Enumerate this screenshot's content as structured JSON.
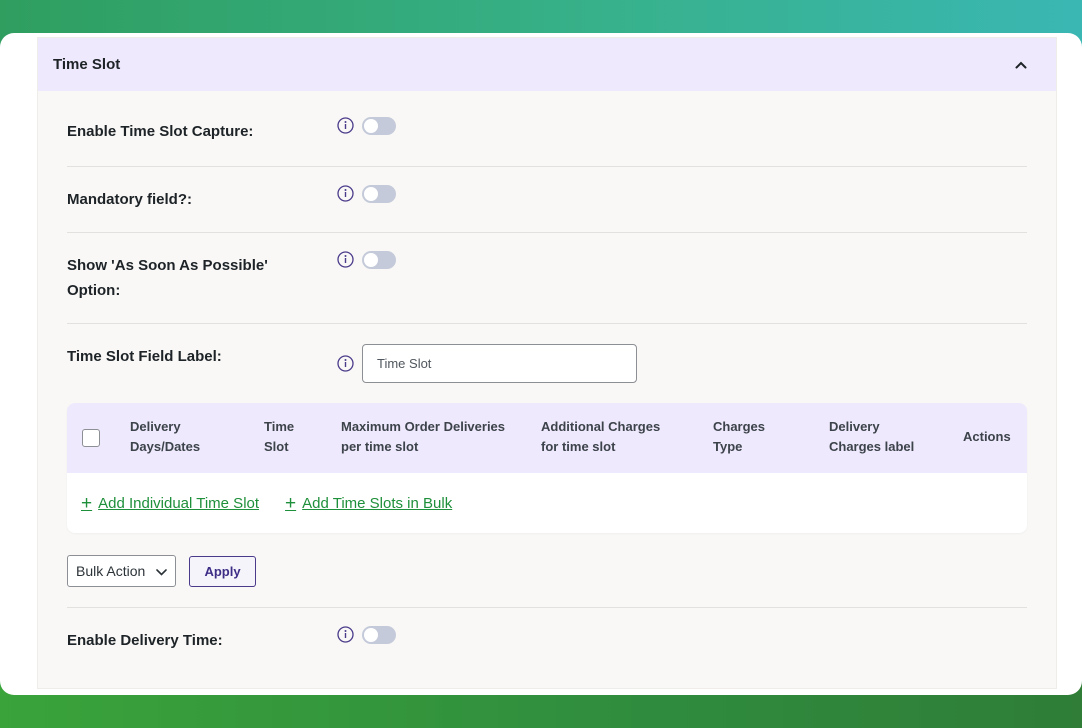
{
  "section": {
    "title": "Time Slot"
  },
  "settings": {
    "enable_capture_label": "Enable Time Slot Capture:",
    "mandatory_label": "Mandatory field?:",
    "asap_label_line1": "Show 'As Soon As Possible'",
    "asap_label_line2": "Option:",
    "field_label_label": "Time Slot Field Label:",
    "field_label_value": "Time Slot",
    "enable_delivery_time_label": "Enable Delivery Time:"
  },
  "table": {
    "headers": [
      {
        "line1": "Delivery",
        "line2": "Days/Dates"
      },
      {
        "line1": "Time",
        "line2": "Slot"
      },
      {
        "line1": "Maximum Order Deliveries",
        "line2": "per time slot"
      },
      {
        "line1": "Additional Charges",
        "line2": "for time slot"
      },
      {
        "line1": "Charges",
        "line2": "Type"
      },
      {
        "line1": "Delivery",
        "line2": "Charges label"
      },
      {
        "line1": "Actions",
        "line2": ""
      }
    ],
    "add_individual": "Add Individual Time Slot",
    "add_bulk": "Add Time Slots in Bulk"
  },
  "bulk": {
    "select_value": "Bulk Action",
    "apply_label": "Apply"
  },
  "colors": {
    "accent_purple": "#3d2d86",
    "header_bg": "#efe9fd",
    "link_green": "#1e8f3a"
  }
}
